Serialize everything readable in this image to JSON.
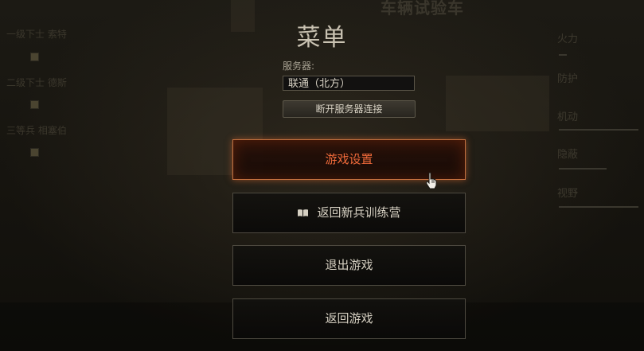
{
  "menu": {
    "title": "菜单",
    "server_label": "服务器:",
    "server_value": "联通（北方）",
    "disconnect_label": "断开服务器连接",
    "buttons": [
      {
        "label": "游戏设置",
        "active": true
      },
      {
        "label": "返回新兵训练营",
        "icon": "book-icon"
      },
      {
        "label": "退出游戏"
      },
      {
        "label": "返回游戏"
      }
    ]
  },
  "background": {
    "title": "车辆试验车",
    "crew": [
      "一级下士 索特",
      "二级下士 德斯",
      "三等兵 相塞伯"
    ],
    "stats": [
      "火力",
      "防护",
      "机动",
      "隐蔽",
      "视野"
    ]
  },
  "colors": {
    "active_border": "#c2703f",
    "active_text": "#f06a3a",
    "text": "#d6d0c2"
  }
}
